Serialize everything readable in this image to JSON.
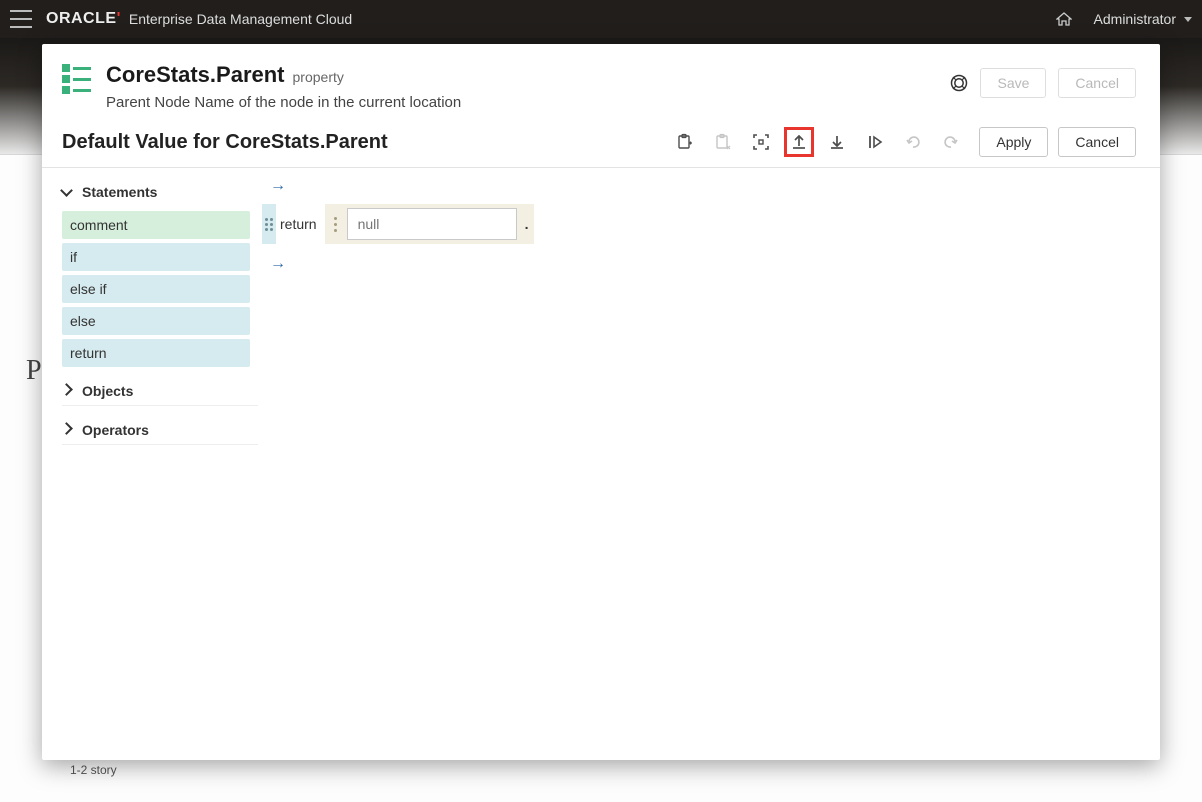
{
  "masthead": {
    "brand": "ORACLE",
    "product": "Enterprise Data Management Cloud",
    "user": "Administrator"
  },
  "background": {
    "page_hint": "Pr",
    "row_label": "1-2 story"
  },
  "dialog": {
    "title": "CoreStats.Parent",
    "title_tag": "property",
    "subtitle": "Parent Node Name of the node in the current location",
    "save_label": "Save",
    "cancel_label": "Cancel"
  },
  "toolbar": {
    "section_title": "Default Value for CoreStats.Parent",
    "apply_label": "Apply",
    "cancel_label": "Cancel",
    "icons": {
      "paste": "paste-icon",
      "paste_disabled": "paste-special-icon",
      "focus": "focus-icon",
      "upload": "upload-icon",
      "download": "download-icon",
      "run": "run-icon",
      "undo": "undo-icon",
      "redo": "redo-icon"
    }
  },
  "palette": {
    "sections": [
      {
        "label": "Statements",
        "expanded": true,
        "items": [
          {
            "label": "comment",
            "kind": "comment"
          },
          {
            "label": "if",
            "kind": "stmt"
          },
          {
            "label": "else if",
            "kind": "stmt"
          },
          {
            "label": "else",
            "kind": "stmt"
          },
          {
            "label": "return",
            "kind": "stmt"
          }
        ]
      },
      {
        "label": "Objects",
        "expanded": false,
        "items": []
      },
      {
        "label": "Operators",
        "expanded": false,
        "items": []
      }
    ]
  },
  "expr": {
    "return_kw": "return",
    "value_placeholder": "null"
  }
}
